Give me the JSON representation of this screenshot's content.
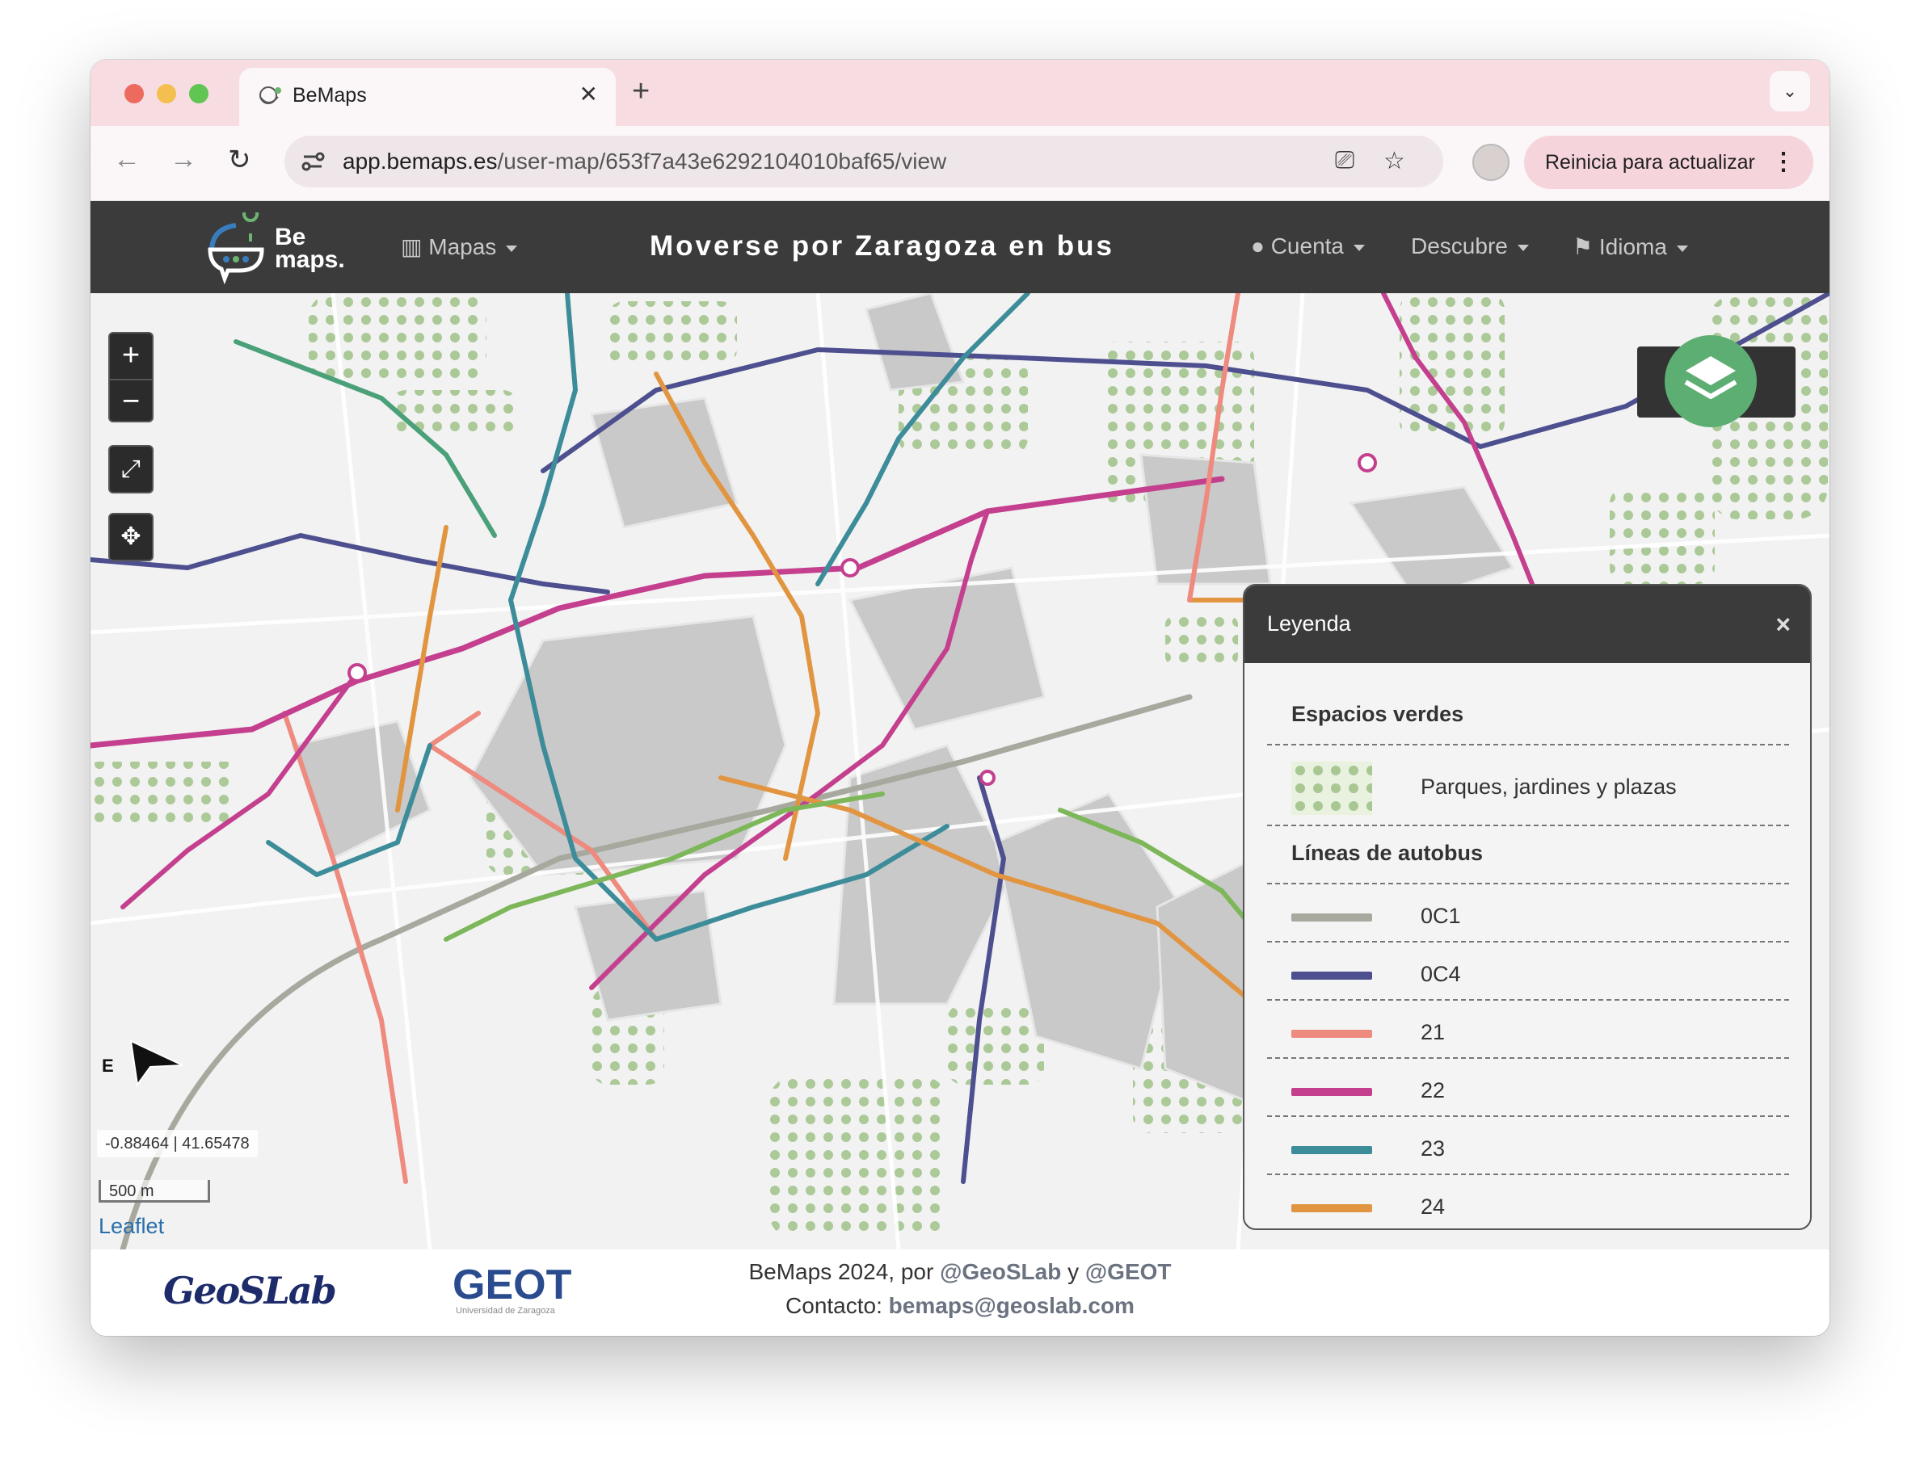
{
  "browser": {
    "tab_title": "BeMaps",
    "url_host": "app.bemaps.es",
    "url_path": "/user-map/653f7a43e6292104010baf65/view",
    "relaunch_label": "Reinicia para actualizar"
  },
  "app": {
    "logo_line1": "Be",
    "logo_line2": "maps.",
    "nav_maps": "Mapas",
    "title": "Moverse por Zaragoza en bus",
    "nav_account": "Cuenta",
    "nav_discover": "Descubre",
    "nav_language": "Idioma"
  },
  "map": {
    "zoom_in": "+",
    "zoom_out": "−",
    "coordinates": "-0.88464 | 41.65478",
    "scale_label": "500 m",
    "attribution": "Leaflet",
    "compass_label": "E"
  },
  "legend": {
    "title": "Leyenda",
    "close": "×",
    "green_section": "Espacios verdes",
    "green_label": "Parques, jardines y plazas",
    "bus_section": "Líneas de autobus",
    "lines": [
      {
        "label": "0C1",
        "color": "#a7a99f"
      },
      {
        "label": "0C4",
        "color": "#4d4f8f"
      },
      {
        "label": "21",
        "color": "#ee8a7e"
      },
      {
        "label": "22",
        "color": "#c4408f"
      },
      {
        "label": "23",
        "color": "#3d8c99"
      },
      {
        "label": "24",
        "color": "#e29541"
      }
    ]
  },
  "footer": {
    "line1_prefix": "BeMaps 2024, por ",
    "line1_geoslab": "@GeoSLab",
    "line1_and": " y ",
    "line1_geot": "@GEOT",
    "line2_prefix": "Contacto: ",
    "line2_email": "bemaps@geoslab.com",
    "logo_geoslab": "GeoSLab",
    "logo_geot": "GEOT",
    "logo_geot_sub": "Universidad de Zaragoza"
  }
}
